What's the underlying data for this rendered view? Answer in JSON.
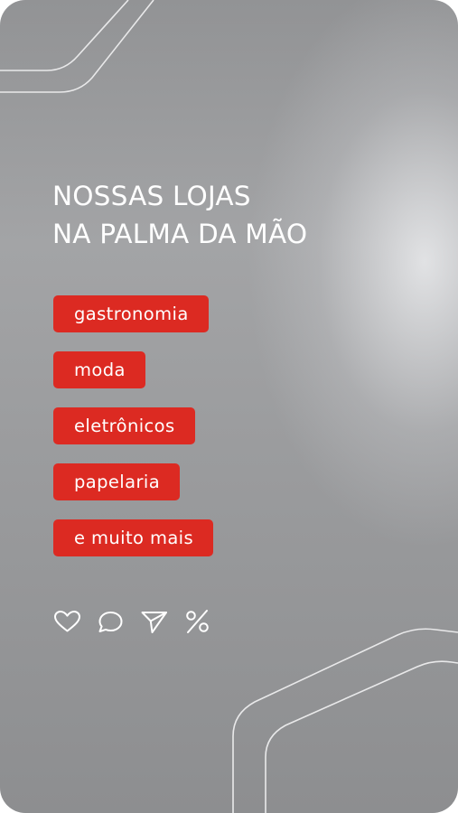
{
  "post": {
    "headline": {
      "line1": "NOSSAS LOJAS",
      "line2": "NA PALMA DA MÃO"
    },
    "categories": [
      {
        "label": "gastronomia"
      },
      {
        "label": "moda"
      },
      {
        "label": "eletrônicos"
      },
      {
        "label": "papelaria"
      },
      {
        "label": "e muito mais"
      }
    ],
    "actions": [
      "heart-icon",
      "comment-icon",
      "send-icon",
      "percent-icon"
    ]
  },
  "colors": {
    "accent": "#dc2a22",
    "background": "#9d9ea0",
    "text": "#ffffff"
  }
}
